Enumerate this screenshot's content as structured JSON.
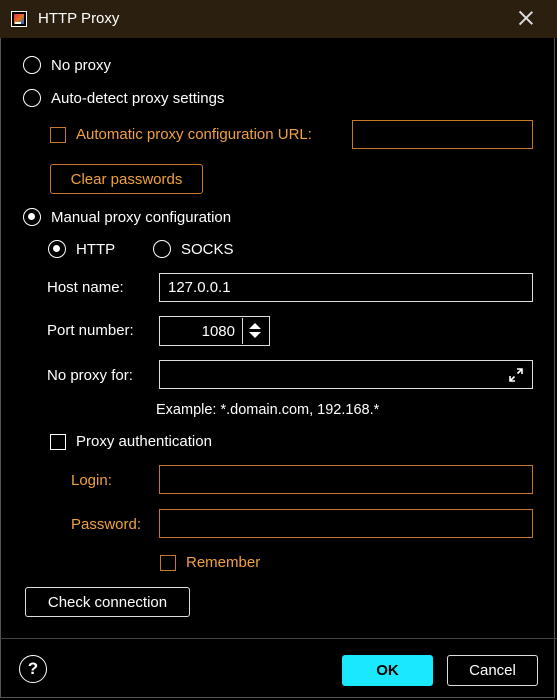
{
  "window": {
    "title": "HTTP Proxy"
  },
  "options": {
    "no_proxy": "No proxy",
    "auto_detect": "Auto-detect proxy settings",
    "auto_config_url_label": "Automatic proxy configuration URL:",
    "auto_config_url_value": "",
    "clear_passwords": "Clear passwords",
    "manual": "Manual proxy configuration",
    "selected": "manual"
  },
  "manual": {
    "protocol_http": "HTTP",
    "protocol_socks": "SOCKS",
    "protocol_selected": "HTTP",
    "host_label": "Host name:",
    "host_value": "127.0.0.1",
    "port_label": "Port number:",
    "port_value": "1080",
    "no_proxy_for_label": "No proxy for:",
    "no_proxy_for_value": "",
    "example": "Example: *.domain.com, 192.168.*"
  },
  "auth": {
    "proxy_authentication": "Proxy authentication",
    "login_label": "Login:",
    "login_value": "",
    "password_label": "Password:",
    "password_value": "",
    "remember": "Remember"
  },
  "footer": {
    "check_connection": "Check connection",
    "help": "?",
    "ok": "OK",
    "cancel": "Cancel"
  },
  "colors": {
    "accent": "#1ae8ff",
    "disabled": "#f0a040",
    "titlebar": "#2b1f10"
  },
  "icons": {
    "app": "intellij-idea-icon",
    "close": "close-icon",
    "expand": "expand-icon",
    "help": "help-icon"
  }
}
